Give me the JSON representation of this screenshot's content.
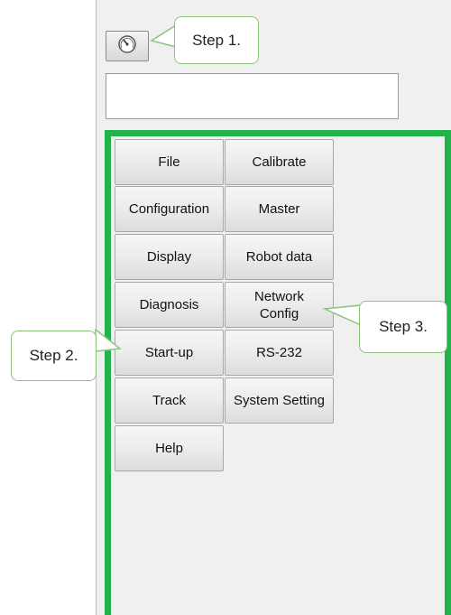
{
  "toolbar": {
    "icon": "speedometer-gauge-icon"
  },
  "menu": {
    "left_column": [
      "File",
      "Configuration",
      "Display",
      "Diagnosis",
      "Start-up",
      "Track",
      "Help"
    ],
    "right_column": [
      "Calibrate",
      "Master",
      "Robot data",
      "Network\nConfig",
      "RS-232",
      "System Setting"
    ]
  },
  "callouts": {
    "step1": "Step 1.",
    "step2": "Step 2.",
    "step3": "Step 3."
  },
  "colors": {
    "frame_accent": "#21b24b",
    "callout_border": "#8cc37a"
  }
}
